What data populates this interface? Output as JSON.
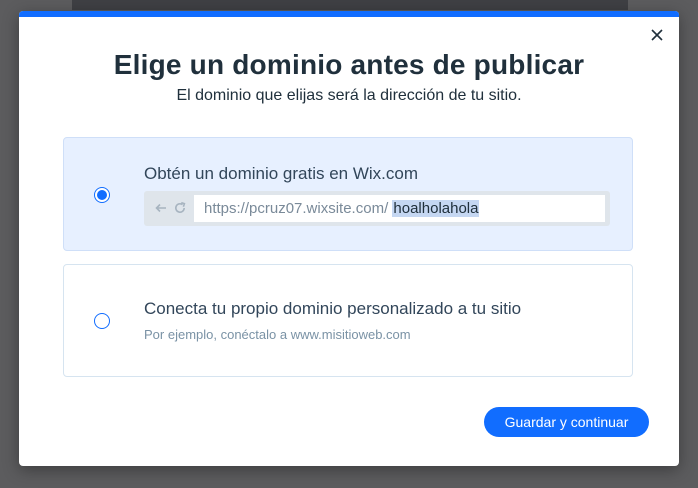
{
  "dialog": {
    "title": "Elige un dominio antes de publicar",
    "subtitle": "El dominio que elijas será la dirección de tu sitio.",
    "close_icon": "close-icon"
  },
  "options": [
    {
      "label": "Obtén un dominio gratis en Wix.com",
      "selected": true,
      "url_prefix": "https://pcruz07.wixsite.com/ ",
      "url_value": "hoalholahola"
    },
    {
      "label": "Conecta tu propio dominio personalizado a tu sitio",
      "hint": "Por ejemplo, conéctalo a www.misitioweb.com",
      "selected": false
    }
  ],
  "actions": {
    "primary_label": "Guardar y continuar"
  },
  "colors": {
    "accent": "#116dff",
    "selected_bg": "#e7f0ff",
    "text_dark": "#20303c"
  }
}
